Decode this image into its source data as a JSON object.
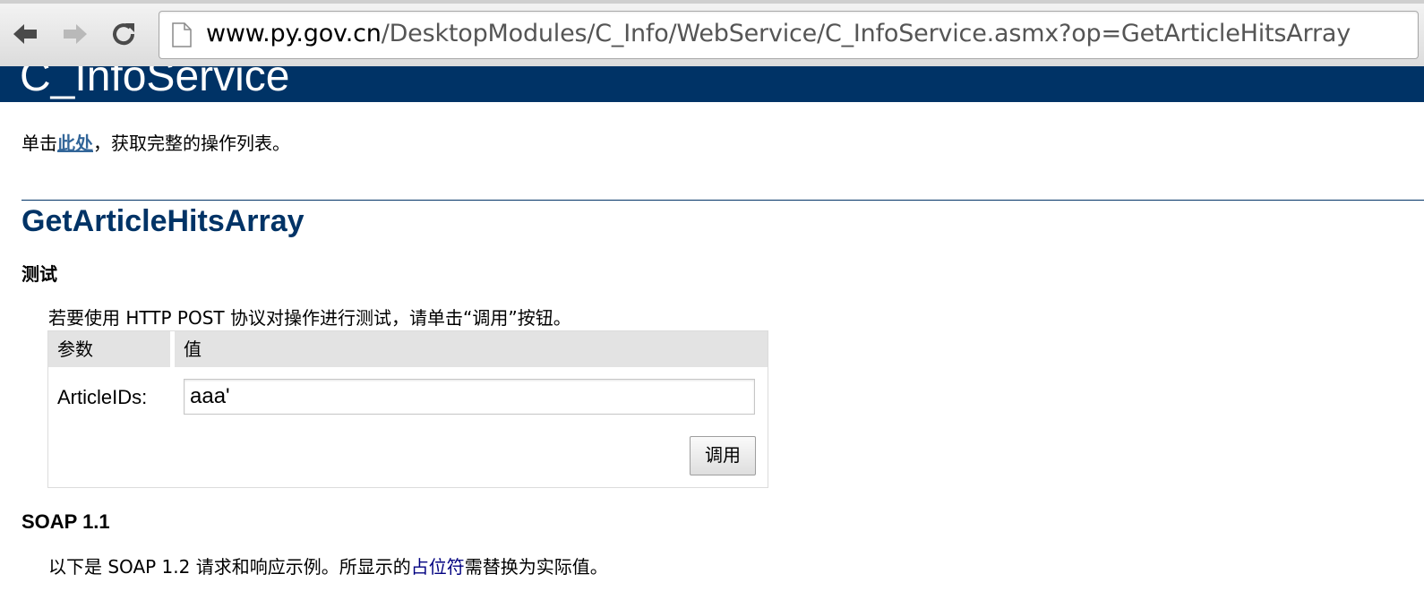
{
  "browser": {
    "url_host": "www.py.gov.cn",
    "url_path": "/DesktopModules/C_Info/WebService/C_InfoService.asmx?op=GetArticleHitsArray"
  },
  "page": {
    "service_name": "C_InfoService",
    "intro_prefix": "单击",
    "intro_link": "此处",
    "intro_suffix": "，获取完整的操作列表。",
    "operation_name": "GetArticleHitsArray",
    "test_heading": "测试",
    "test_description": "若要使用 HTTP POST 协议对操作进行测试，请单击“调用”按钮。",
    "table": {
      "header_param": "参数",
      "header_value": "值",
      "param_label": "ArticleIDs:",
      "param_value": "aaa'",
      "invoke_label": "调用"
    },
    "soap_heading": "SOAP 1.1",
    "soap_desc_prefix": "以下是 SOAP 1.2 请求和响应示例。所显示的",
    "soap_desc_link": "占位符",
    "soap_desc_suffix": "需替换为实际值。"
  },
  "icons": {
    "back": "back-arrow-icon",
    "forward": "forward-arrow-icon",
    "reload": "reload-icon",
    "page": "page-document-icon"
  },
  "colors": {
    "banner": "#003366",
    "heading": "#003366",
    "link": "#336699",
    "placeholder_link": "#000080"
  }
}
